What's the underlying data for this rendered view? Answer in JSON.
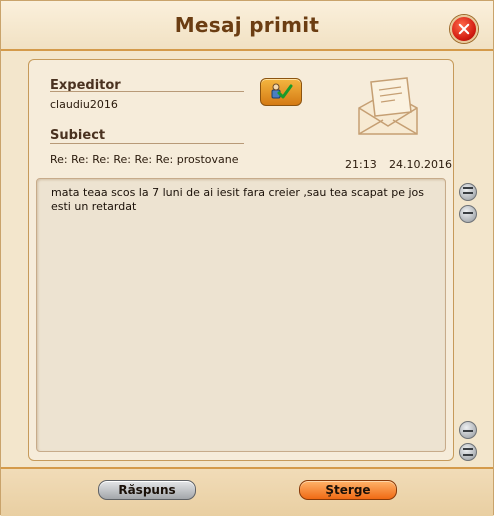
{
  "window": {
    "title": "Mesaj primit"
  },
  "message": {
    "sender_label": "Expeditor",
    "sender": "claudiu2016",
    "subject_label": "Subiect",
    "subject": "Re: Re: Re: Re: Re: Re: prostovane",
    "time": "21:13",
    "date": "24.10.2016",
    "body": "mata teaa scos la 7 luni de ai iesit fara creier ,sau tea scapat pe jos\nesti un retardat"
  },
  "actions": {
    "reply_label": "Răspuns",
    "delete_label": "Şterge"
  },
  "colors": {
    "title": "#6b3d12",
    "accent": "#f06a14",
    "close": "#d21a10"
  }
}
